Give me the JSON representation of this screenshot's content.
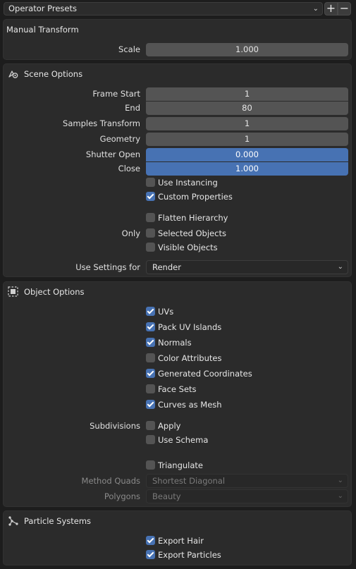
{
  "presets": {
    "label": "Operator Presets",
    "add_label": "+",
    "remove_label": "−"
  },
  "manual_transform": {
    "title": "Manual Transform",
    "scale_label": "Scale",
    "scale_value": "1.000"
  },
  "scene_options": {
    "title": "Scene Options",
    "icon": "scene-icon",
    "frame_start_label": "Frame Start",
    "frame_start_value": "1",
    "end_label": "End",
    "end_value": "80",
    "samples_transform_label": "Samples Transform",
    "samples_transform_value": "1",
    "geometry_label": "Geometry",
    "geometry_value": "1",
    "shutter_open_label": "Shutter Open",
    "shutter_open_value": "0.000",
    "close_label": "Close",
    "close_value": "1.000",
    "use_instancing": {
      "label": "Use Instancing",
      "checked": false
    },
    "custom_properties": {
      "label": "Custom Properties",
      "checked": true
    },
    "flatten_hierarchy": {
      "label": "Flatten Hierarchy",
      "checked": false
    },
    "only_label": "Only",
    "selected_objects": {
      "label": "Selected Objects",
      "checked": false
    },
    "visible_objects": {
      "label": "Visible Objects",
      "checked": false
    },
    "use_settings_label": "Use Settings for",
    "use_settings_value": "Render"
  },
  "object_options": {
    "title": "Object Options",
    "icon": "object-icon",
    "uvs": {
      "label": "UVs",
      "checked": true
    },
    "pack_uv_islands": {
      "label": "Pack UV Islands",
      "checked": true
    },
    "normals": {
      "label": "Normals",
      "checked": true
    },
    "color_attributes": {
      "label": "Color Attributes",
      "checked": false
    },
    "generated_coordinates": {
      "label": "Generated Coordinates",
      "checked": true
    },
    "face_sets": {
      "label": "Face Sets",
      "checked": false
    },
    "curves_as_mesh": {
      "label": "Curves as Mesh",
      "checked": true
    },
    "subdivisions_label": "Subdivisions",
    "apply": {
      "label": "Apply",
      "checked": false
    },
    "use_schema": {
      "label": "Use Schema",
      "checked": false
    },
    "triangulate": {
      "label": "Triangulate",
      "checked": false
    },
    "method_quads_label": "Method Quads",
    "method_quads_value": "Shortest Diagonal",
    "polygons_label": "Polygons",
    "polygons_value": "Beauty"
  },
  "particle_systems": {
    "title": "Particle Systems",
    "icon": "particles-icon",
    "export_hair": {
      "label": "Export Hair",
      "checked": true
    },
    "export_particles": {
      "label": "Export Particles",
      "checked": true
    }
  },
  "colors": {
    "accent": "#4772b3",
    "panel_bg": "#2b2b2b",
    "field_bg": "#545454",
    "app_bg": "#1d1d1d"
  }
}
